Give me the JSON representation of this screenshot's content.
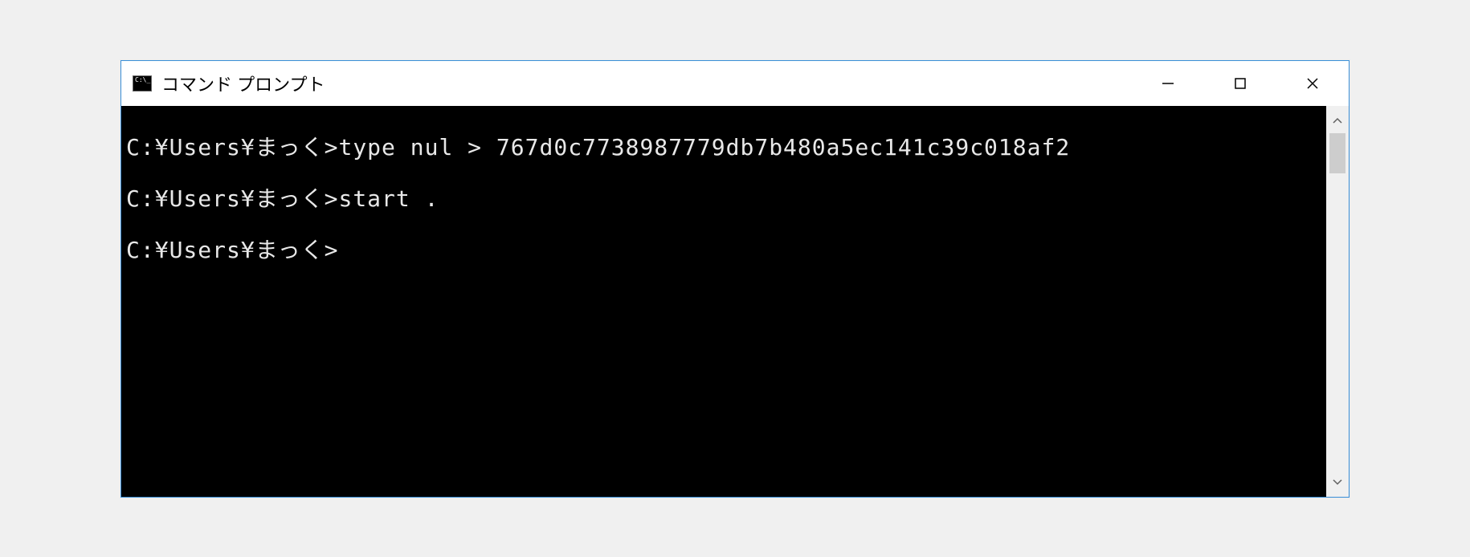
{
  "window": {
    "title": "コマンド プロンプト"
  },
  "terminal": {
    "lines": [
      {
        "prompt": "C:¥Users¥まっく>",
        "command": "type nul > 767d0c7738987779db7b480a5ec141c39c018af2"
      },
      {
        "prompt": "C:¥Users¥まっく>",
        "command": "start ."
      },
      {
        "prompt": "C:¥Users¥まっく>",
        "command": ""
      }
    ]
  }
}
